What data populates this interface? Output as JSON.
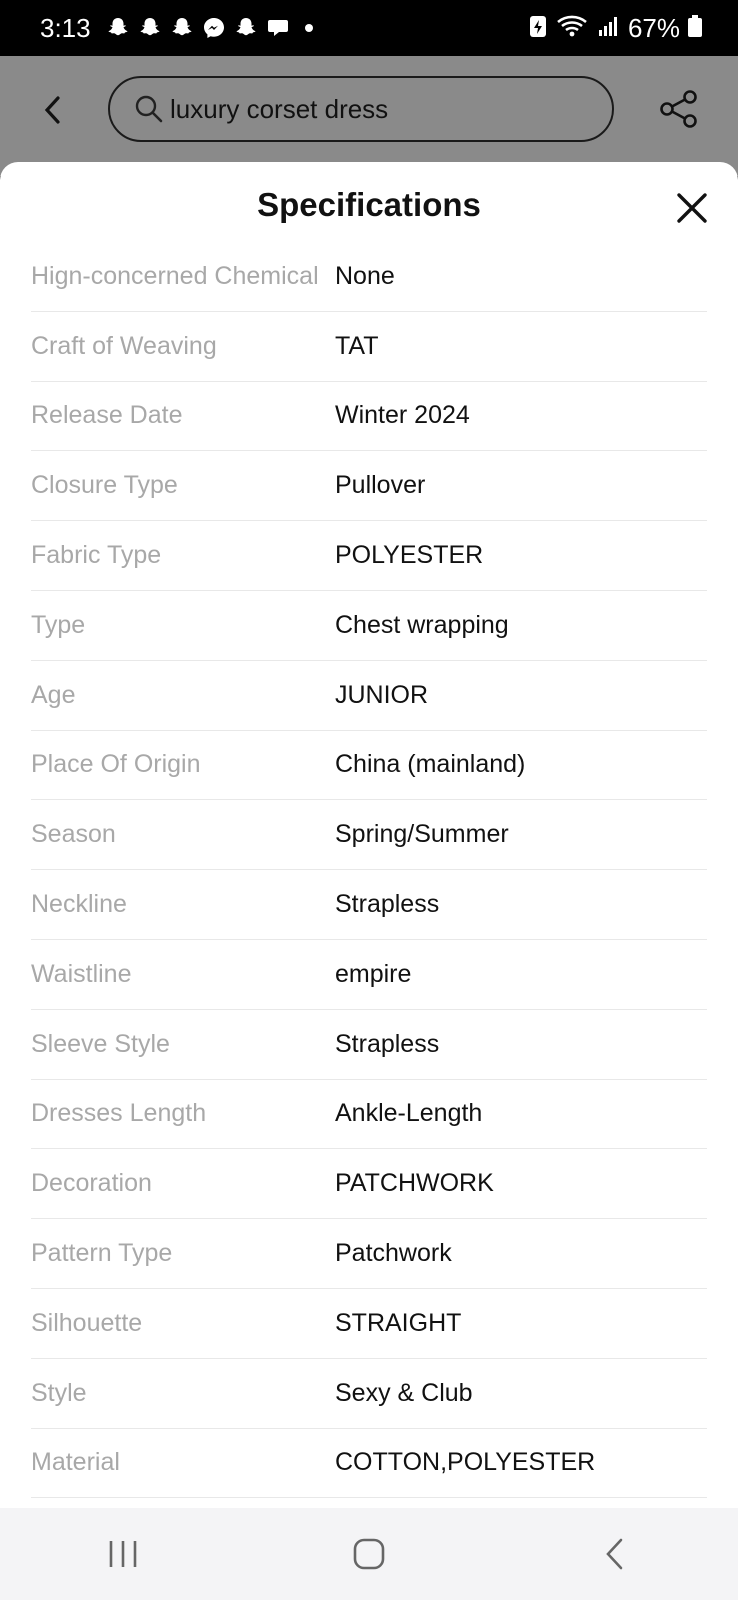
{
  "status_bar": {
    "time": "3:13",
    "battery": "67%",
    "notification_icons": [
      "snapchat-icon",
      "snapchat-icon",
      "snapchat-icon",
      "messenger-icon",
      "snapchat-icon",
      "chat-icon"
    ]
  },
  "header": {
    "search_query": "luxury corset dress"
  },
  "sheet": {
    "title": "Specifications",
    "specs": [
      {
        "label": "Hign-concerned Chemical",
        "value": "None"
      },
      {
        "label": "Craft of Weaving",
        "value": "TAT"
      },
      {
        "label": "Release Date",
        "value": "Winter 2024"
      },
      {
        "label": "Closure Type",
        "value": "Pullover"
      },
      {
        "label": "Fabric Type",
        "value": "POLYESTER"
      },
      {
        "label": "Type",
        "value": "Chest wrapping"
      },
      {
        "label": "Age",
        "value": "JUNIOR"
      },
      {
        "label": "Place Of Origin",
        "value": "China (mainland)"
      },
      {
        "label": "Season",
        "value": "Spring/Summer"
      },
      {
        "label": "Neckline",
        "value": "Strapless"
      },
      {
        "label": "Waistline",
        "value": "empire"
      },
      {
        "label": "Sleeve Style",
        "value": "Strapless"
      },
      {
        "label": "Dresses Length",
        "value": "Ankle-Length"
      },
      {
        "label": "Decoration",
        "value": "PATCHWORK"
      },
      {
        "label": "Pattern Type",
        "value": "Patchwork"
      },
      {
        "label": "Silhouette",
        "value": "STRAIGHT"
      },
      {
        "label": "Style",
        "value": "Sexy & Club"
      },
      {
        "label": "Material",
        "value": "COTTON,POLYESTER"
      }
    ]
  },
  "colors": {
    "overlay": "#8a8a8a",
    "label": "#a8a8a8",
    "value": "#111111",
    "divider": "#e8e8e8",
    "nav_bg": "#f4f4f6"
  }
}
